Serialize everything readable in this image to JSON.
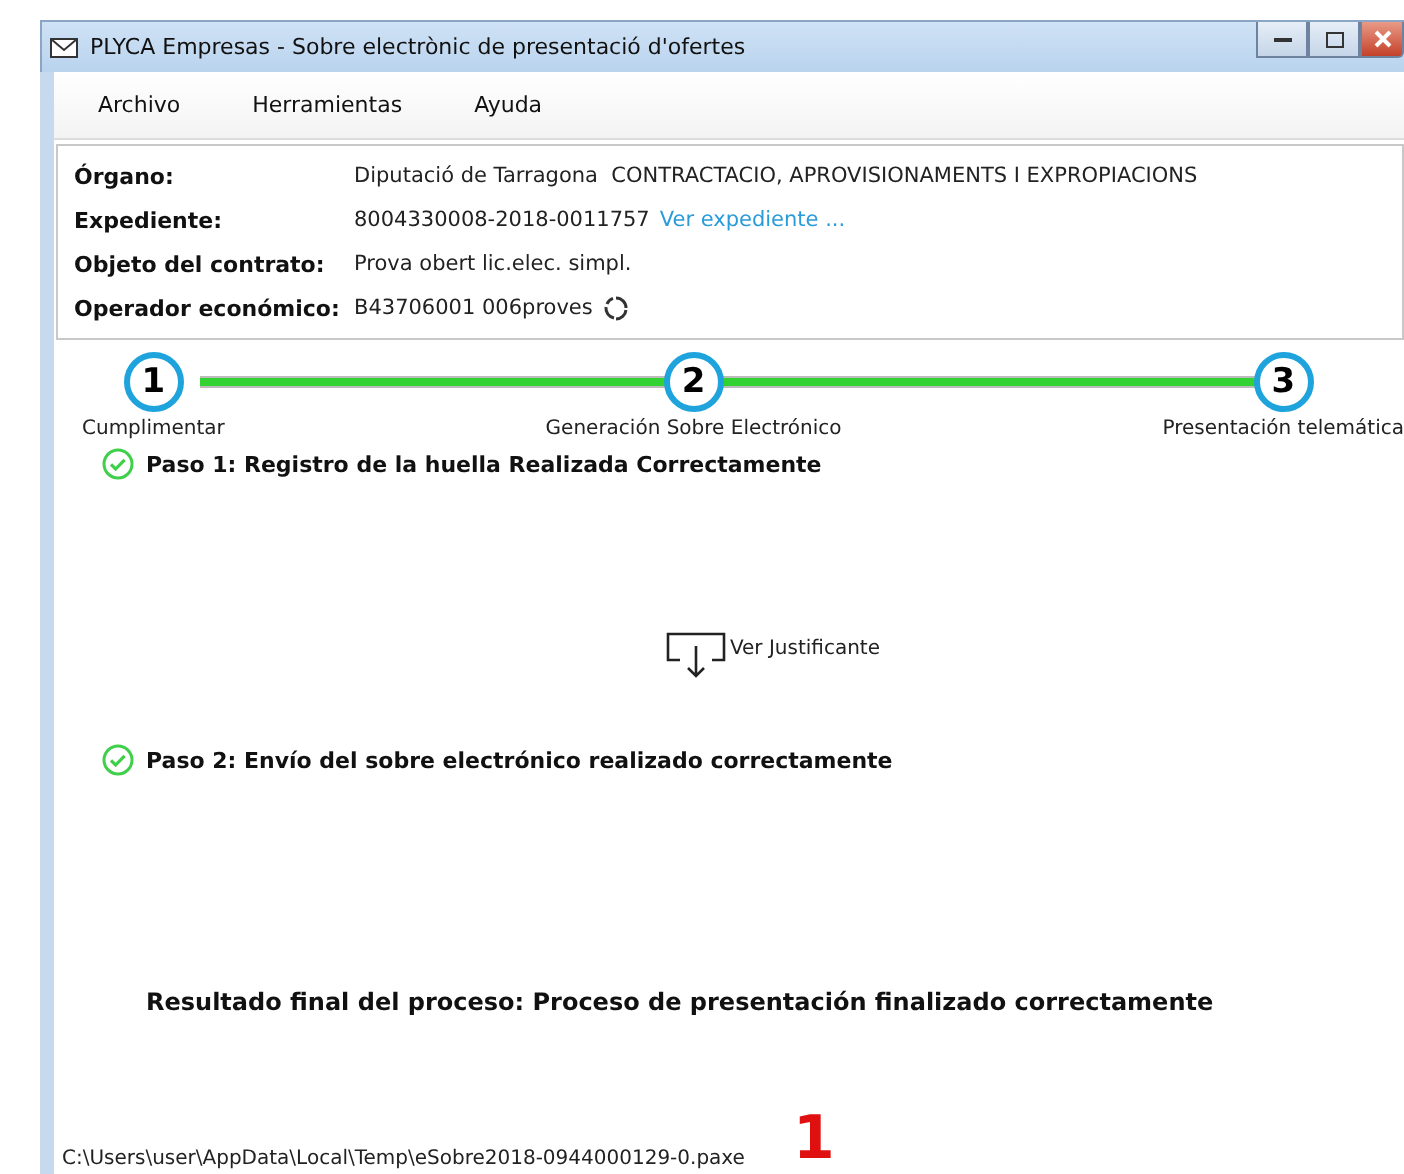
{
  "window": {
    "title": "PLYCA Empresas - Sobre electrònic de presentació d'ofertes"
  },
  "menu": [
    "Archivo",
    "Herramientas",
    "Ayuda"
  ],
  "info": [
    {
      "label": "Órgano:",
      "value": "Diputació de Tarragona  CONTRACTACIO, APROVISIONAMENTS I EXPROPIACIONS"
    },
    {
      "label": "Expediente:",
      "value": "8004330008-2018-0011757",
      "link": "Ver expediente ..."
    },
    {
      "label": "Objeto del contrato:",
      "value": "Prova obert lic.elec. simpl."
    },
    {
      "label": "Operador económico:",
      "value": "B43706001 006proves",
      "spinner": true
    }
  ],
  "steps": [
    {
      "number": "1",
      "label": "Cumplimentar"
    },
    {
      "number": "2",
      "label": "Generación Sobre Electrónico"
    },
    {
      "number": "3",
      "label": "Presentación telemática"
    }
  ],
  "paso1": "Paso 1: Registro de la huella Realizada Correctamente",
  "justificante": "Ver Justificante",
  "paso2": "Paso 2: Envío del sobre electrónico realizado correctamente",
  "resultado": "Resultado final del proceso: Proceso de presentación finalizado correctamente",
  "status_bar": "C:\\Users\\user\\AppData\\Local\\Temp\\eSobre2018-0944000129-0.paxe",
  "annotation": "1"
}
